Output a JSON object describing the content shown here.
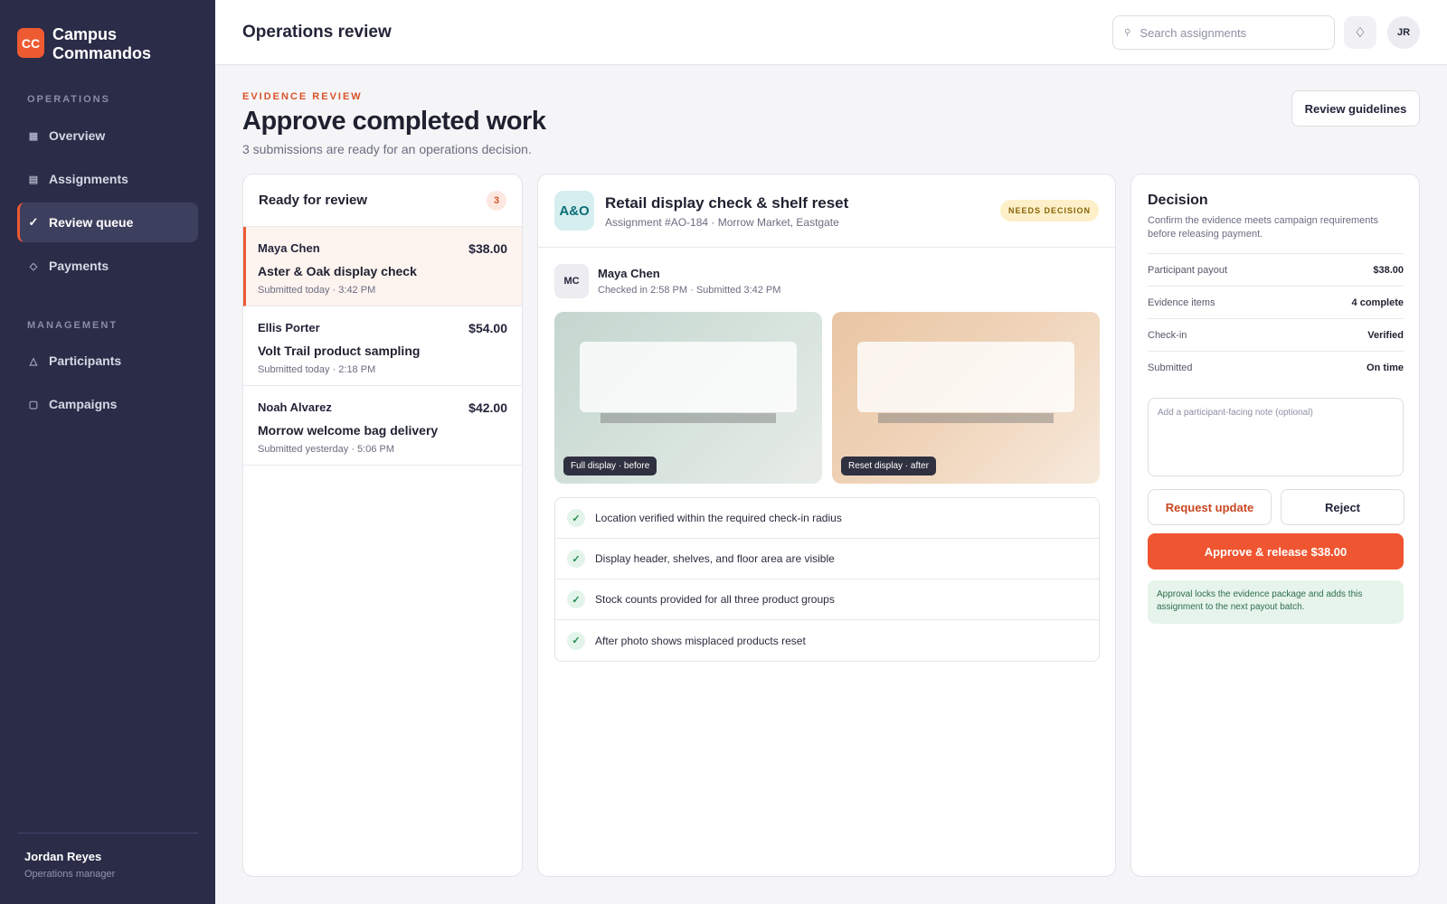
{
  "brand": {
    "logo": "CC",
    "name": "Campus Commandos"
  },
  "sidebar": {
    "sections": [
      {
        "label": "OPERATIONS"
      },
      {
        "label": "MANAGEMENT"
      }
    ],
    "items": [
      {
        "label": "Overview",
        "icon": "grid-icon"
      },
      {
        "label": "Assignments",
        "icon": "list-icon"
      },
      {
        "label": "Review queue",
        "icon": "check-icon",
        "active": true
      },
      {
        "label": "Payments",
        "icon": "diamond-icon"
      },
      {
        "label": "Participants",
        "icon": "person-icon"
      },
      {
        "label": "Campaigns",
        "icon": "square-icon"
      }
    ],
    "user": {
      "name": "Jordan Reyes",
      "role": "Operations manager"
    }
  },
  "header": {
    "title": "Operations review",
    "search_placeholder": "Search assignments",
    "icon_button": "diamond-icon",
    "avatar": "JR"
  },
  "page": {
    "eyebrow": "EVIDENCE REVIEW",
    "title": "Approve completed work",
    "subtitle": "3 submissions are ready for an operations decision.",
    "guidelines_label": "Review guidelines"
  },
  "queue": {
    "title": "Ready for review",
    "count": "3",
    "items": [
      {
        "name": "Maya Chen",
        "amount": "$38.00",
        "title": "Aster & Oak display check",
        "time": "Submitted today · 3:42 PM"
      },
      {
        "name": "Ellis Porter",
        "amount": "$54.00",
        "title": "Volt Trail product sampling",
        "time": "Submitted today · 2:18 PM"
      },
      {
        "name": "Noah Alvarez",
        "amount": "$42.00",
        "title": "Morrow welcome bag delivery",
        "time": "Submitted yesterday · 5:06 PM"
      }
    ]
  },
  "detail": {
    "logo": "A&O",
    "title": "Retail display check & shelf reset",
    "subtitle": "Assignment #AO-184 · Morrow Market, Eastgate",
    "status": "NEEDS DECISION",
    "submitter": {
      "initials": "MC",
      "name": "Maya Chen",
      "meta": "Checked in 2:58 PM · Submitted 3:42 PM"
    },
    "photos": [
      {
        "label": "Full display · before"
      },
      {
        "label": "Reset display · after"
      }
    ],
    "checks": [
      "Location verified within the required check-in radius",
      "Display header, shelves, and floor area are visible",
      "Stock counts provided for all three product groups",
      "After photo shows misplaced products reset"
    ]
  },
  "decision": {
    "title": "Decision",
    "description": "Confirm the evidence meets campaign requirements before releasing payment.",
    "rows": [
      {
        "label": "Participant payout",
        "value": "$38.00"
      },
      {
        "label": "Evidence items",
        "value": "4 complete"
      },
      {
        "label": "Check-in",
        "value": "Verified"
      },
      {
        "label": "Submitted",
        "value": "On time"
      }
    ],
    "note_placeholder": "Add a participant-facing note (optional)",
    "request_label": "Request update",
    "reject_label": "Reject",
    "approve_label": "Approve & release $38.00",
    "info": "Approval locks the evidence package and adds this assignment to the next payout batch."
  },
  "colors": {
    "accent": "#ee5a32",
    "sidebar": "#2a2c48",
    "success": "#1f8a50"
  }
}
